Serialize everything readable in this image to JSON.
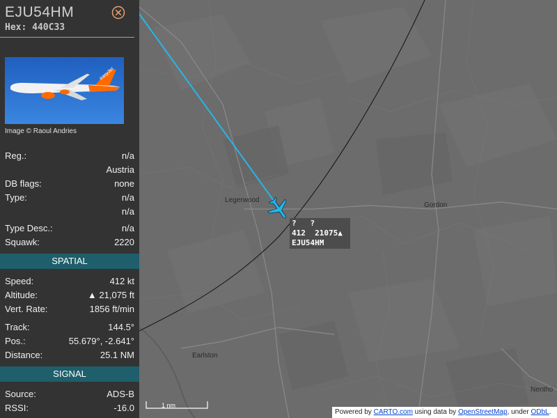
{
  "aircraft": {
    "callsign": "EJU54HM",
    "hex_label": "Hex:",
    "hex": "440C33",
    "photo_credit": "Image © Raoul Andries"
  },
  "info": {
    "reg_label": "Reg.:",
    "reg": "n/a",
    "country": "Austria",
    "dbflags_label": "DB flags:",
    "dbflags": "none",
    "type_label": "Type:",
    "type": "n/a",
    "type2": "n/a",
    "typedesc_label": "Type Desc.:",
    "typedesc": "n/a",
    "squawk_label": "Squawk:",
    "squawk": "2220"
  },
  "spatial": {
    "header": "SPATIAL",
    "speed_label": "Speed:",
    "speed": "412 kt",
    "altitude_label": "Altitude:",
    "altitude": "▲ 21,075 ft",
    "vrate_label": "Vert. Rate:",
    "vrate": "1856 ft/min",
    "track_label": "Track:",
    "track": "144.5°",
    "pos_label": "Pos.:",
    "pos": "55.679°, -2.641°",
    "distance_label": "Distance:",
    "distance": "25.1 NM"
  },
  "signal": {
    "header": "SIGNAL",
    "source_label": "Source:",
    "source": "ADS-B",
    "rssi_label": "RSSI:",
    "rssi": "-16.0"
  },
  "map": {
    "places": {
      "legerwood": "Legerwood",
      "gordon": "Gordon",
      "earlston": "Earlston",
      "nenthorn": "Nentho"
    },
    "scale": "1 nm",
    "track_color": "#27b6e8",
    "aircraft_color": "#27b6e8",
    "label": {
      "line1": "?   ?",
      "line2": "412  21075▲",
      "line3": "EJU54HM"
    },
    "attribution": {
      "prefix": "Powered by ",
      "carto": "CARTO.com",
      "middle": " using data by ",
      "osm": "OpenStreetMap",
      "under": ", under ",
      "odbl": "ODbL",
      "end": "."
    }
  }
}
